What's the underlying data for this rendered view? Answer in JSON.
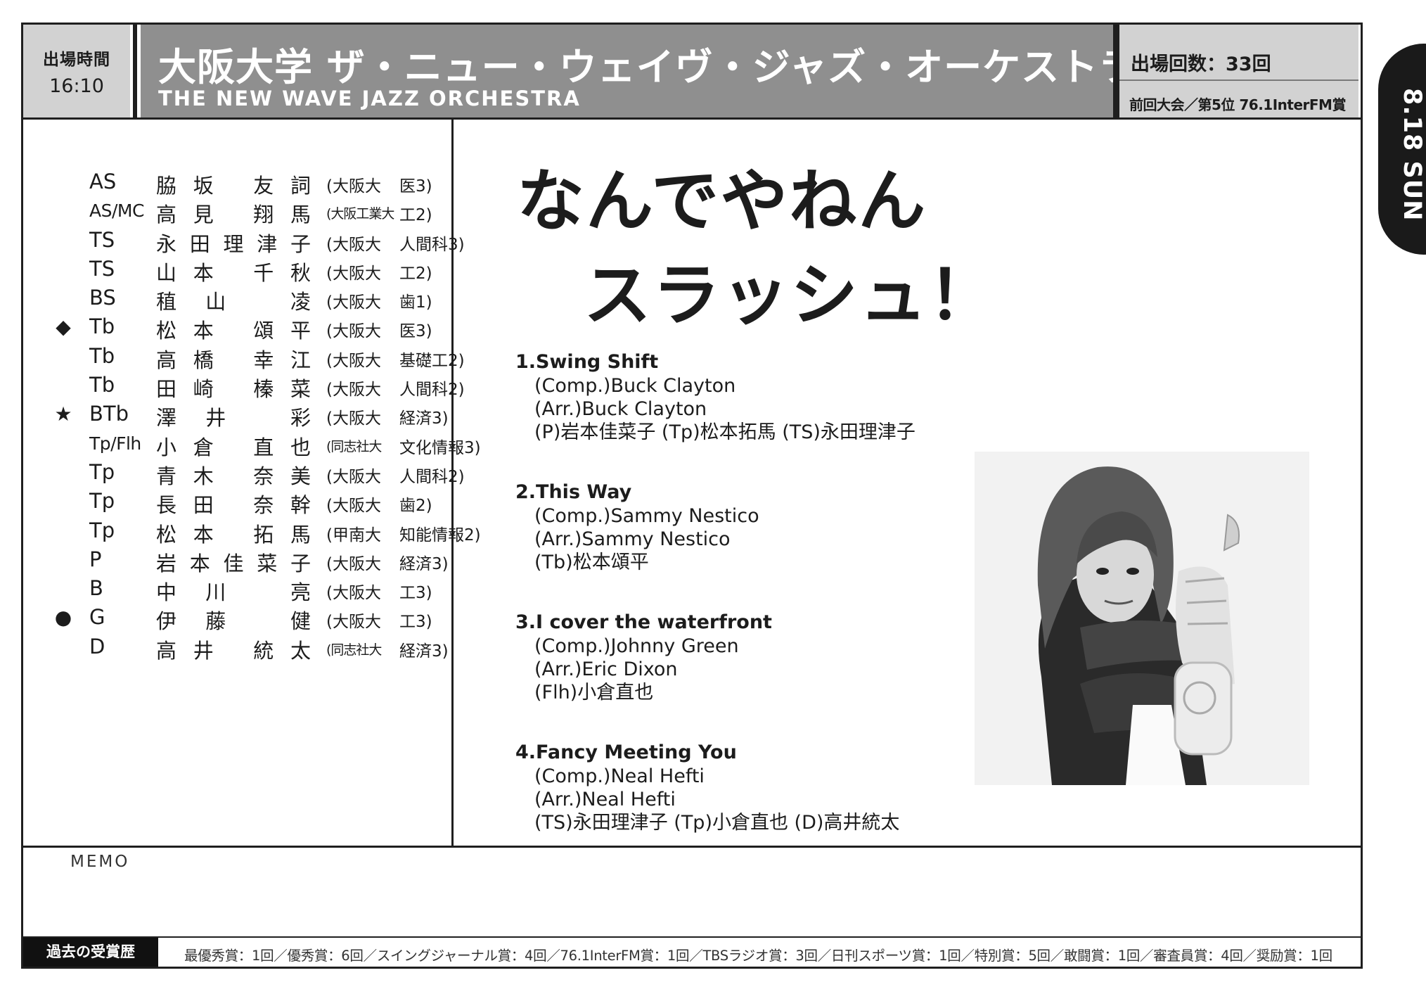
{
  "header": {
    "time_label": "出場時間",
    "time_value": "16:10",
    "title_jp": "大阪大学 ザ・ニュー・ウェイヴ・ジャズ・オーケストラ",
    "title_en": "THE NEW WAVE JAZZ ORCHESTRA",
    "appearances": "出場回数：33回",
    "previous_result": "前回大会／第5位 76.1InterFM賞"
  },
  "date_tab": "8.18 SUN",
  "members": [
    {
      "mark": "",
      "inst": "AS",
      "name": "脇坂 友詞",
      "school": "(大阪大",
      "dept": "医3)"
    },
    {
      "mark": "",
      "inst": "AS/MC",
      "name": "高見 翔馬",
      "school": "(大阪工業大",
      "dept": "工2)"
    },
    {
      "mark": "",
      "inst": "TS",
      "name": "永田理津子",
      "school": "(大阪大",
      "dept": "人間科3)"
    },
    {
      "mark": "",
      "inst": "TS",
      "name": "山本 千秋",
      "school": "(大阪大",
      "dept": "工2)"
    },
    {
      "mark": "",
      "inst": "BS",
      "name": "稙山 凌",
      "school": "(大阪大",
      "dept": "歯1)"
    },
    {
      "mark": "◆",
      "inst": "Tb",
      "name": "松本 頌平",
      "school": "(大阪大",
      "dept": "医3)"
    },
    {
      "mark": "",
      "inst": "Tb",
      "name": "高橋 幸江",
      "school": "(大阪大",
      "dept": "基礎工2)"
    },
    {
      "mark": "",
      "inst": "Tb",
      "name": "田崎 榛菜",
      "school": "(大阪大",
      "dept": "人間科2)"
    },
    {
      "mark": "★",
      "inst": "BTb",
      "name": "澤井 彩",
      "school": "(大阪大",
      "dept": "経済3)"
    },
    {
      "mark": "",
      "inst": "Tp/Flh",
      "name": "小倉 直也",
      "school": "(同志社大",
      "dept": "文化情報3)"
    },
    {
      "mark": "",
      "inst": "Tp",
      "name": "青木 奈美",
      "school": "(大阪大",
      "dept": "人間科2)"
    },
    {
      "mark": "",
      "inst": "Tp",
      "name": "長田 奈幹",
      "school": "(大阪大",
      "dept": "歯2)"
    },
    {
      "mark": "",
      "inst": "Tp",
      "name": "松本 拓馬",
      "school": "(甲南大",
      "dept": "知能情報2)"
    },
    {
      "mark": "",
      "inst": "P",
      "name": "岩本佳菜子",
      "school": "(大阪大",
      "dept": "経済3)"
    },
    {
      "mark": "",
      "inst": "B",
      "name": "中川 亮",
      "school": "(大阪大",
      "dept": "工3)"
    },
    {
      "mark": "●",
      "inst": "G",
      "name": "伊藤 健",
      "school": "(大阪大",
      "dept": "工3)"
    },
    {
      "mark": "",
      "inst": "D",
      "name": "高井 統太",
      "school": "(同志社大",
      "dept": "経済3)"
    }
  ],
  "catchphrase": {
    "line1": "なんでやねん",
    "line2": "スラッシュ！"
  },
  "songs": [
    {
      "title": "1.Swing Shift",
      "lines": [
        "(Comp.)Buck Clayton",
        "(Arr.)Buck Clayton",
        "(P)岩本佳菜子 (Tp)松本拓馬 (TS)永田理津子"
      ]
    },
    {
      "title": "2.This Way",
      "lines": [
        "(Comp.)Sammy Nestico",
        "(Arr.)Sammy Nestico",
        "(Tb)松本頌平"
      ]
    },
    {
      "title": "3.I cover the waterfront",
      "lines": [
        "(Comp.)Johnny Green",
        "(Arr.)Eric Dixon",
        "(Flh)小倉直也"
      ]
    },
    {
      "title": "4.Fancy Meeting You",
      "lines": [
        "(Comp.)Neal Hefti",
        "(Arr.)Neal Hefti",
        "(TS)永田理津子 (Tp)小倉直也 (D)高井統太"
      ]
    }
  ],
  "memo_label": "MEMO",
  "awards": {
    "label": "過去の受賞歴",
    "text": "最優秀賞：1回／優秀賞：6回／スイングジャーナル賞：4回／76.1InterFM賞：1回／TBSラジオ賞：3回／日刊スポーツ賞：1回／特別賞：5回／敢闘賞：1回／審査員賞：4回／奨励賞：1回"
  }
}
